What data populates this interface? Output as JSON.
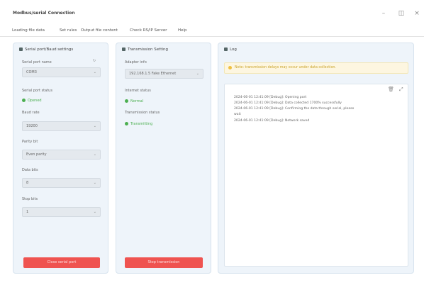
{
  "window": {
    "title": "Modbus/serial Connection"
  },
  "menu": [
    "Loading file data",
    "Set rules",
    "Output file content",
    "Check RS/IP Server",
    "Help"
  ],
  "panels": {
    "serial": {
      "title": "Serial port/Baud settings",
      "port_label": "Serial port name",
      "port_value": "COM3",
      "status_label": "Serial port status",
      "status_value": "Opened",
      "baud_label": "Baud rate",
      "baud_value": "19200",
      "parity_label": "Parity bit",
      "parity_value": "Even parity",
      "databits_label": "Data bits",
      "databits_value": "8",
      "stopbits_label": "Stop bits",
      "stopbits_value": "1",
      "button": "Close serial port"
    },
    "transmission": {
      "title": "Transmission Setting",
      "address_label": "Adapter info",
      "address_value": "192.168.1.5 Fake Ethernet",
      "conn_label": "Internet status",
      "conn_value": "Normal",
      "trans_label": "Transmission status",
      "trans_value": "Transmitting",
      "button": "Stop transmission"
    },
    "log": {
      "title": "Log",
      "warning": "Note: transmission delays may occur under data collection.",
      "lines": [
        "2024-06-01 12:41:09 [Debug]: Opening port",
        "2024-06-01 12:41:09 [Debug]: Data collected 1700% successfully",
        "2024-06-01 12:41:09 [Debug]: Confirming the data through serial, please",
        "wait",
        "2024-06-01 12:41:09 [Debug]: Network saved"
      ]
    }
  }
}
